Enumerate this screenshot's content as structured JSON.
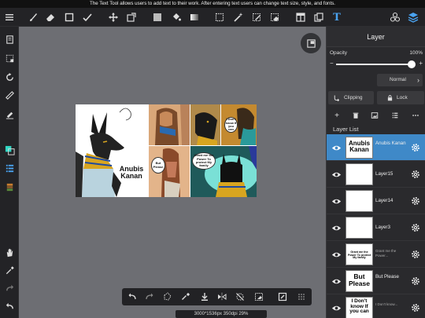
{
  "tip_text": "The Text Tool allows users to add text to their work. After entering text users can change text size, style, and fonts.",
  "toolbar": {
    "icons": [
      "menu-icon",
      "brush-icon",
      "eraser-icon",
      "square-icon",
      "smudge-icon",
      "move-icon",
      "transform-icon",
      "fill-color-icon",
      "bucket-icon",
      "gradient-icon",
      "select-rect-icon",
      "magic-wand-icon",
      "select-pen-icon",
      "select-eraser-icon",
      "layout-icon",
      "copy-icon",
      "text-tool-icon",
      "materials-icon",
      "layers-icon"
    ],
    "text_tool_glyph": "T"
  },
  "canvas": {
    "status": "3000*1536px 350dpi 29%",
    "artwork": {
      "title_line1": "Anubis",
      "title_line2": "Kanan",
      "bubble_but_please": "But Please",
      "bubble_grant": "Grant me the Power To protect My family",
      "bubble_dont": "I Don't know If you can"
    }
  },
  "layer_panel": {
    "header": "Layer",
    "opacity_label": "Opacity",
    "opacity_value": "100%",
    "opacity_fraction": 1.0,
    "blend_mode": "Normal",
    "clipping_label": "Clipping",
    "lock_label": "Lock",
    "list_title": "Layer List",
    "layers": [
      {
        "name": "Anubis Kanan",
        "thumb_text": "Anubis Kanan",
        "selected": true
      },
      {
        "name": "Layer15",
        "thumb_text": "",
        "selected": false
      },
      {
        "name": "Layer14",
        "thumb_text": "",
        "selected": false
      },
      {
        "name": "Layer3",
        "thumb_text": "",
        "selected": false
      },
      {
        "name": "Grant me the Power...",
        "thumb_text": "Grant me the Power To protect My family",
        "selected": false
      },
      {
        "name": "But Please",
        "thumb_text": "But Please",
        "selected": false
      },
      {
        "name": "I Don't know...",
        "thumb_text": "I Don't know If you can",
        "selected": false
      }
    ]
  },
  "colors": {
    "accent": "#3f89c8",
    "canvas_bg": "#6d6e73",
    "toolbar_bg": "#232326",
    "panel_bg": "#2a2a2d"
  }
}
